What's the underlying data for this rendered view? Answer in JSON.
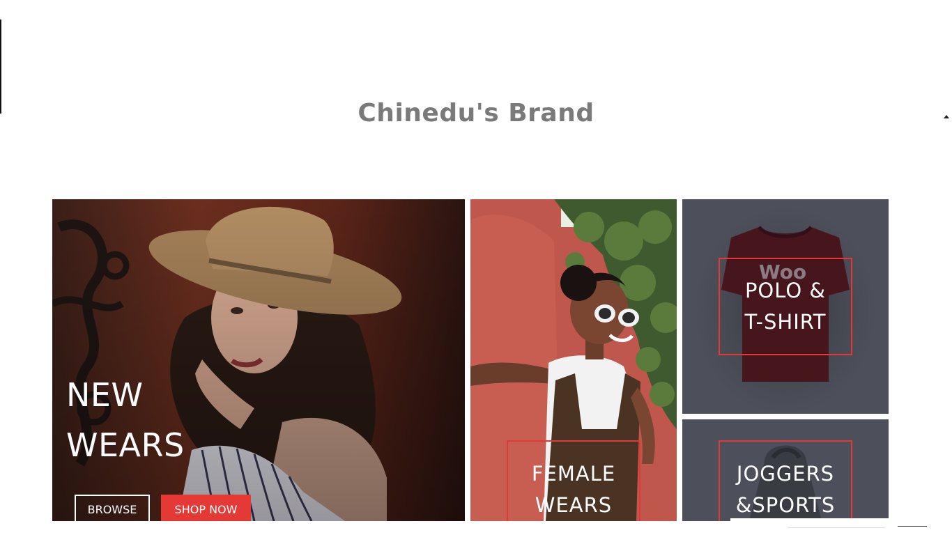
{
  "brand": {
    "name": "Chinedu's Brand"
  },
  "tiles": {
    "new": {
      "line1": "NEW",
      "line2": "WEARS",
      "browse_label": "BROWSE",
      "shop_label": "SHOP NOW"
    },
    "female": {
      "line1": "FEMALE",
      "line2": "WEARS"
    },
    "polo": {
      "line1": "POLO &",
      "line2": "T-SHIRT",
      "shirt_print": "Woo"
    },
    "joggers": {
      "line1": "JOGGERS",
      "line2": "&SPORTS"
    }
  },
  "colors": {
    "accent": "#e53935",
    "tile_bg": "#4d4f5a",
    "brand_text": "#7a7a7a"
  }
}
